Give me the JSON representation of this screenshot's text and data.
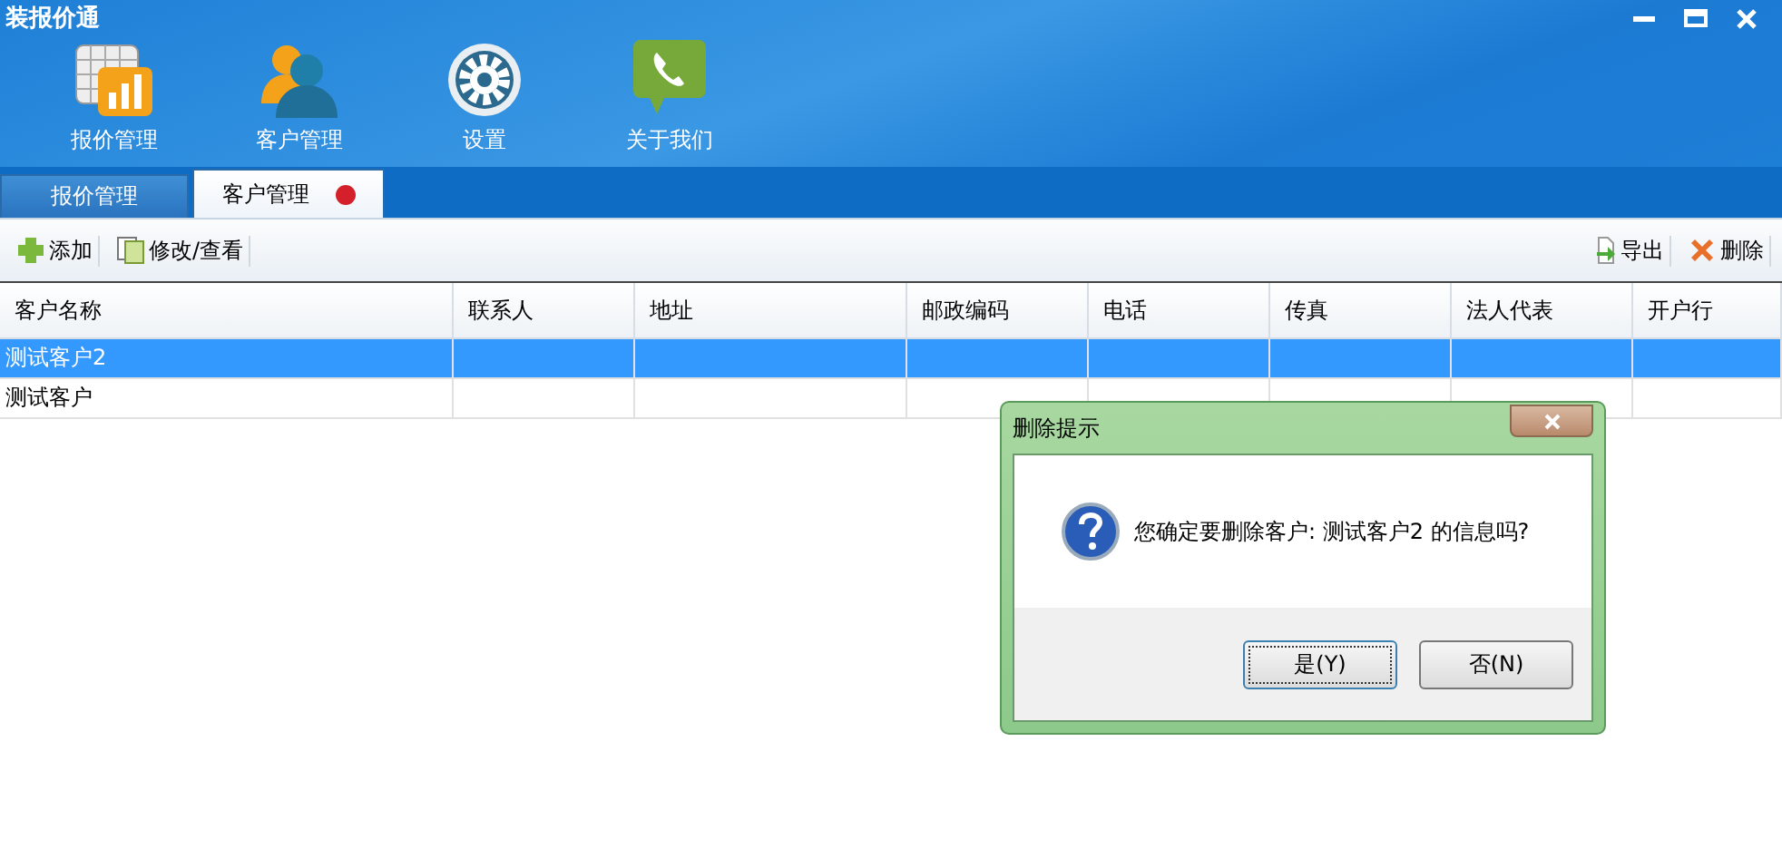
{
  "window": {
    "title": "装报价通"
  },
  "nav": [
    {
      "label": "报价管理",
      "kind": "chart"
    },
    {
      "label": "客户管理",
      "kind": "people"
    },
    {
      "label": "设置",
      "kind": "gear"
    },
    {
      "label": "关于我们",
      "kind": "phone"
    }
  ],
  "tabs": [
    {
      "label": "报价管理",
      "selected": false,
      "closable": false
    },
    {
      "label": "客户管理",
      "selected": true,
      "closable": true
    }
  ],
  "toolbar_left": [
    {
      "label": "添加",
      "kind": "add"
    },
    {
      "label": "修改/查看",
      "kind": "edit"
    }
  ],
  "toolbar_right": [
    {
      "label": "导出",
      "kind": "export"
    },
    {
      "label": "删除",
      "kind": "delete"
    }
  ],
  "table": {
    "columns": [
      "客户名称",
      "联系人",
      "地址",
      "邮政编码",
      "电话",
      "传真",
      "法人代表",
      "开户行"
    ],
    "rows": [
      {
        "selected": true,
        "cells": [
          "测试客户2",
          "",
          "",
          "",
          "",
          "",
          "",
          ""
        ]
      },
      {
        "selected": false,
        "cells": [
          "测试客户",
          "",
          "",
          "",
          "",
          "",
          "",
          ""
        ]
      }
    ]
  },
  "dialog": {
    "title": "删除提示",
    "message": "您确定要删除客户: 测试客户2 的信息吗?",
    "buttons": [
      {
        "label": "是(Y)",
        "selected": true
      },
      {
        "label": "否(N)",
        "selected": false
      }
    ]
  }
}
